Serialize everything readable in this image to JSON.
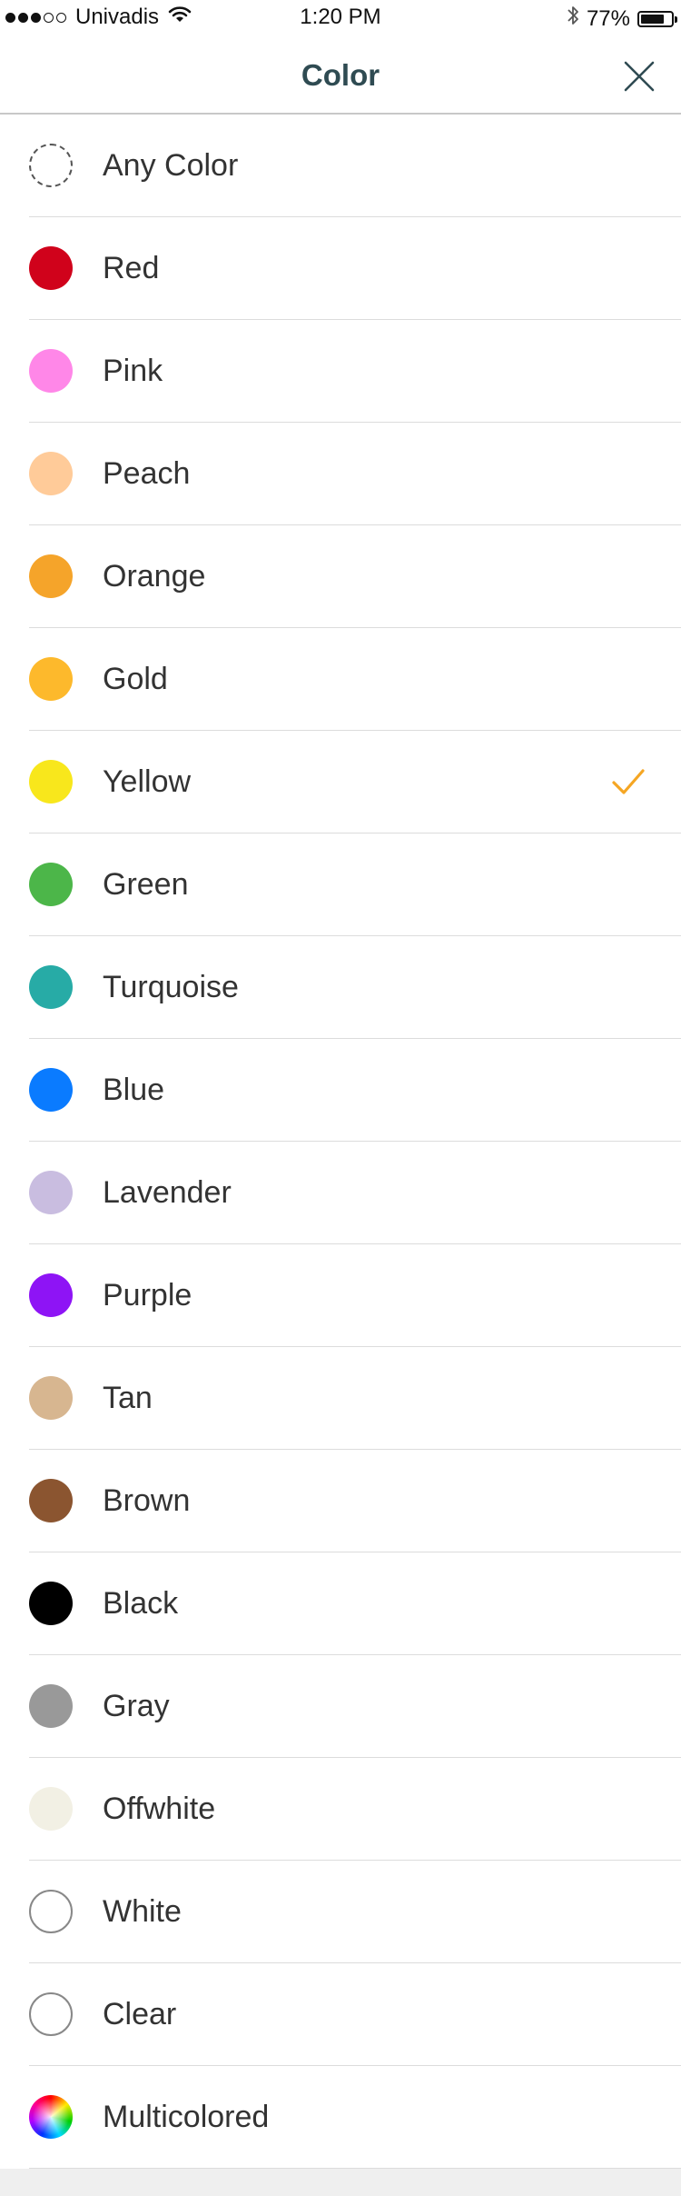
{
  "status_bar": {
    "carrier": "Univadis",
    "time": "1:20 PM",
    "battery_percent": "77%",
    "battery_level": 0.77,
    "signal_bars_filled": 3,
    "signal_bars_total": 5
  },
  "header": {
    "title": "Color",
    "close_icon": "close-icon"
  },
  "selected_color": "Yellow",
  "colors": [
    {
      "label": "Any Color",
      "style": "dashed",
      "hex": "#ffffff"
    },
    {
      "label": "Red",
      "style": "fill",
      "hex": "#d0021b"
    },
    {
      "label": "Pink",
      "style": "fill",
      "hex": "#ff87e8"
    },
    {
      "label": "Peach",
      "style": "fill",
      "hex": "#ffcb99"
    },
    {
      "label": "Orange",
      "style": "fill",
      "hex": "#f5a42a"
    },
    {
      "label": "Gold",
      "style": "fill",
      "hex": "#fdb92c"
    },
    {
      "label": "Yellow",
      "style": "fill",
      "hex": "#f8e71c"
    },
    {
      "label": "Green",
      "style": "fill",
      "hex": "#4cb649"
    },
    {
      "label": "Turquoise",
      "style": "fill",
      "hex": "#27aba6"
    },
    {
      "label": "Blue",
      "style": "fill",
      "hex": "#0a7bff"
    },
    {
      "label": "Lavender",
      "style": "fill",
      "hex": "#c9bde0"
    },
    {
      "label": "Purple",
      "style": "fill",
      "hex": "#8e14f5"
    },
    {
      "label": "Tan",
      "style": "fill",
      "hex": "#d7b690"
    },
    {
      "label": "Brown",
      "style": "fill",
      "hex": "#8b5530"
    },
    {
      "label": "Black",
      "style": "fill",
      "hex": "#000000"
    },
    {
      "label": "Gray",
      "style": "fill",
      "hex": "#999999"
    },
    {
      "label": "Offwhite",
      "style": "fill",
      "hex": "#f2f0e4"
    },
    {
      "label": "White",
      "style": "outline",
      "hex": "#ffffff"
    },
    {
      "label": "Clear",
      "style": "outline",
      "hex": "#ffffff"
    },
    {
      "label": "Multicolored",
      "style": "multi",
      "hex": "#ffffff"
    }
  ],
  "accent_color": "#f5a623"
}
